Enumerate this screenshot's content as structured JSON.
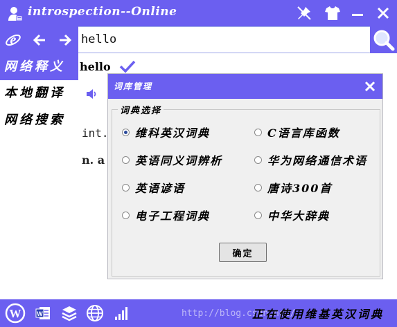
{
  "window": {
    "title": "introspection--Online"
  },
  "titlebar": {
    "icons": [
      "user-icon",
      "pin-off-icon",
      "tshirt-icon",
      "minimize-icon",
      "close-icon"
    ]
  },
  "nav": {
    "icons": [
      "ie-icon",
      "back-arrow-icon",
      "forward-arrow-icon"
    ]
  },
  "search": {
    "value": "hello",
    "placeholder": ""
  },
  "sidebar": {
    "items": [
      {
        "label": "网络释义",
        "active": true
      },
      {
        "label": "本地翻译",
        "active": false
      },
      {
        "label": "网络搜索",
        "active": false
      }
    ]
  },
  "main": {
    "word": "hello",
    "background_line1": "int.",
    "background_line2": "n.  a"
  },
  "dialog": {
    "title": "词库管理",
    "group_label": "词典选择",
    "options": [
      {
        "label": "维科英汉词典",
        "checked": true
      },
      {
        "label": "C语言库函数",
        "checked": false
      },
      {
        "label": "英语同义词辨析",
        "checked": false
      },
      {
        "label": "华为网络通信术语",
        "checked": false
      },
      {
        "label": "英语谚语",
        "checked": false
      },
      {
        "label": "唐诗300首",
        "checked": false
      },
      {
        "label": "电子工程词典",
        "checked": false
      },
      {
        "label": "中华大辞典",
        "checked": false
      }
    ],
    "ok_label": "确定"
  },
  "bottombar": {
    "icons": [
      "wordpress-icon",
      "word-doc-icon",
      "layers-icon",
      "globe-icon",
      "signal-bars-icon"
    ],
    "status": "正在使用维基英汉词典",
    "watermark": "http://blog.csdn.net/"
  },
  "colors": {
    "accent": "#6b5ff0",
    "dialog_bg": "#f0f0f0",
    "white": "#ffffff"
  }
}
